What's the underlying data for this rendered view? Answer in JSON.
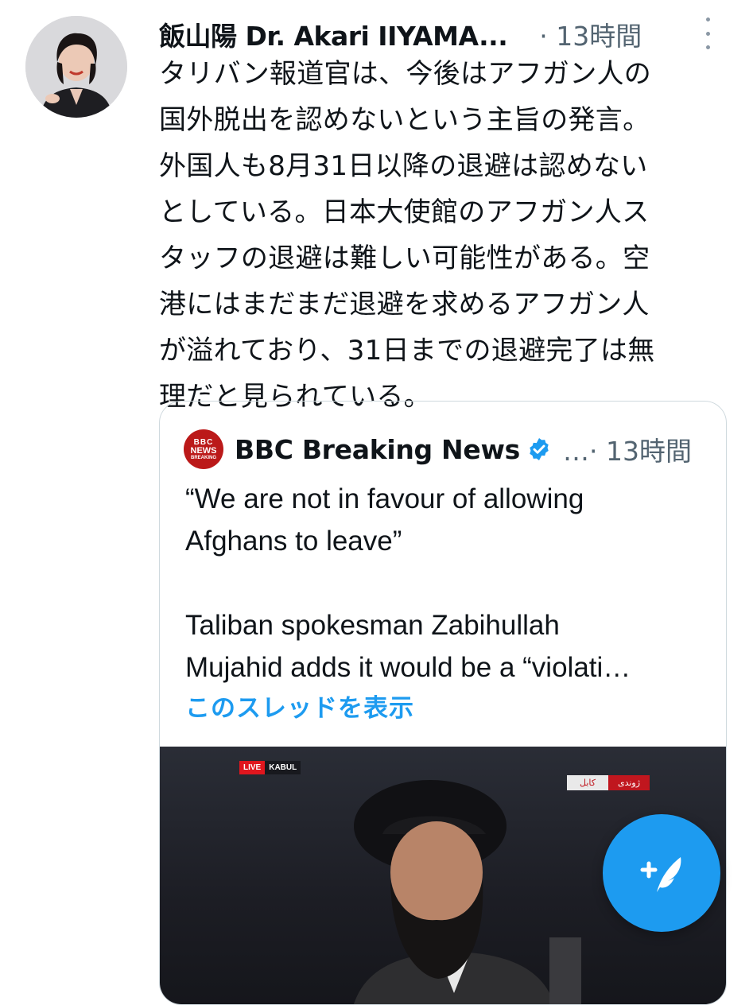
{
  "tweet": {
    "author": "飯山陽 Dr. Akari IIYAMA...",
    "time": "· 13時間",
    "text": "タリバン報道官は、今後はアフガン人の\n国外脱出を認めないという主旨の発言。\n外国人も8月31日以降の退避は認めない\nとしている。日本大使館のアフガン人ス\nタッフの退避は難しい可能性がある。空\n港にはまだまだ退避を求めるアフガン人\nが溢れており、31日までの退避完了は無\n理だと見られている。"
  },
  "quote": {
    "logo_line1": "BBC",
    "logo_line2": "NEWS",
    "logo_line3": "BREAKING",
    "author": "BBC Breaking News",
    "meta": "…· 13時間",
    "text": "“We are not in favour of allowing\nAfghans to leave”\n\nTaliban spokesman Zabihullah\nMujahid adds it would be a “violati…",
    "show_thread": "このスレッドを表示"
  },
  "video": {
    "live_label": "LIVE",
    "city_label": "KABUL",
    "farsi_left": "کابل",
    "farsi_right": "ژوندی"
  },
  "icons": {
    "more": "more-vertical-icon",
    "verified": "verified-badge-icon",
    "compose": "compose-tweet-icon"
  },
  "colors": {
    "accent": "#1d9bf0",
    "secondary_text": "#536471",
    "bbc_red": "#bb1919",
    "live_red": "#e0161e"
  }
}
